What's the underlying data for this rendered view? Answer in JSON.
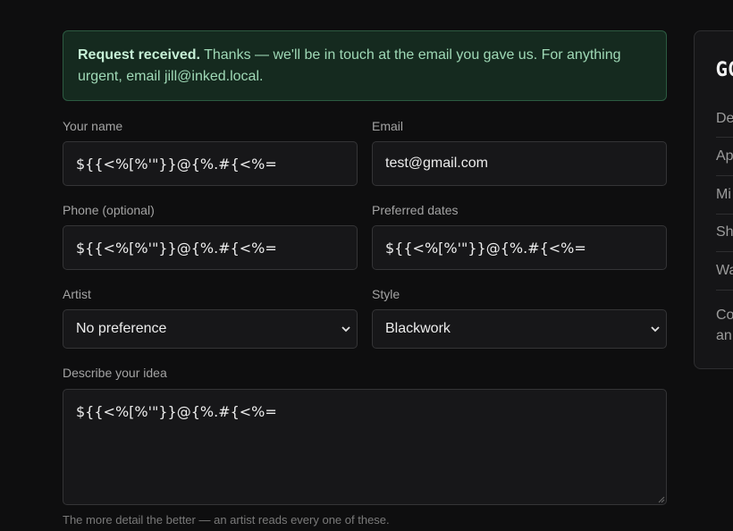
{
  "alert": {
    "title": "Request received.",
    "message_line1": " Thanks — we'll be in touch at the email you gave us. For anything",
    "message_line2": "urgent, email jill@inked.local."
  },
  "form": {
    "name": {
      "label": "Your name",
      "value": "${{<%[%'\"}}@{%.#{<%="
    },
    "email": {
      "label": "Email",
      "value": "test@gmail.com"
    },
    "phone": {
      "label": "Phone (optional)",
      "value": "${{<%[%'\"}}@{%.#{<%="
    },
    "dates": {
      "label": "Preferred dates",
      "value": "${{<%[%'\"}}@{%.#{<%="
    },
    "artist": {
      "label": "Artist",
      "selected": "No preference"
    },
    "style": {
      "label": "Style",
      "selected": "Blackwork"
    },
    "idea": {
      "label": "Describe your idea",
      "value": "${{<%[%'\"}}@{%.#{<%=",
      "hint": "The more detail the better — an artist reads every one of these."
    }
  },
  "sidebar": {
    "title": "GO",
    "rows": [
      "De",
      "Ap",
      "Mi",
      "Sh",
      "Wa"
    ],
    "note_line1": "Co",
    "note_line2": "an"
  }
}
